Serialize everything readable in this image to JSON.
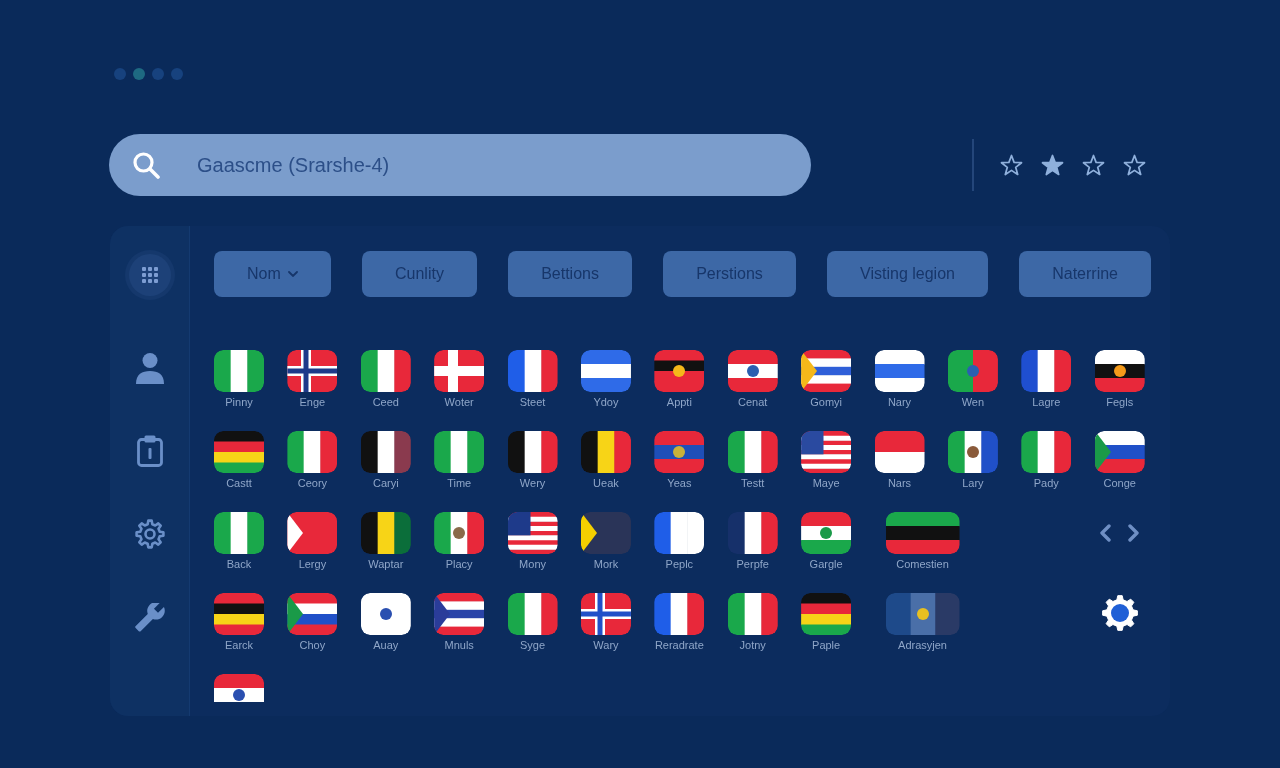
{
  "page_dots": [
    {
      "selected": false
    },
    {
      "selected": true
    },
    {
      "selected": false
    },
    {
      "selected": false
    }
  ],
  "search": {
    "value": "Gaascme (Srarshe-4)"
  },
  "star_buttons": [
    {
      "filled": false
    },
    {
      "filled": true
    },
    {
      "filled": false
    },
    {
      "filled": false
    }
  ],
  "sidebar": {
    "items": [
      {
        "kind": "grid",
        "selected": true
      },
      {
        "kind": "person",
        "selected": false
      },
      {
        "kind": "clipboard",
        "selected": false
      },
      {
        "kind": "gear",
        "selected": false
      },
      {
        "kind": "wrench",
        "selected": false
      }
    ]
  },
  "filters": [
    {
      "label": "Nom",
      "dropdown": true
    },
    {
      "label": "Cunlity"
    },
    {
      "label": "Bettions"
    },
    {
      "label": "Perstions"
    },
    {
      "label": "Visting legion"
    },
    {
      "label": "Naterrine"
    }
  ],
  "flag_grid": {
    "rows": [
      {
        "tiles": [
          {
            "label": "Pinny"
          },
          {
            "label": "Enge"
          },
          {
            "label": "Ceed"
          },
          {
            "label": "Woter"
          },
          {
            "label": "Steet"
          },
          {
            "label": "Ydoy"
          },
          {
            "label": "Appti"
          },
          {
            "label": "Cenat"
          },
          {
            "label": "Gomyi"
          },
          {
            "label": "Nary"
          },
          {
            "label": "Wen"
          },
          {
            "label": "Lagre"
          },
          {
            "label": "Fegls"
          }
        ]
      },
      {
        "tiles": [
          {
            "label": "Castt"
          },
          {
            "label": "Ceory"
          },
          {
            "label": "Caryi"
          },
          {
            "label": "Time"
          },
          {
            "label": "Wery"
          },
          {
            "label": "Ueak"
          },
          {
            "label": "Yeas"
          },
          {
            "label": "Testt"
          },
          {
            "label": "Maye"
          },
          {
            "label": "Nars"
          },
          {
            "label": "Lary"
          },
          {
            "label": "Pady"
          },
          {
            "label": "Conge"
          }
        ]
      },
      {
        "tiles": [
          {
            "label": "Back"
          },
          {
            "label": "Lergy"
          },
          {
            "label": "Waptar"
          },
          {
            "label": "Placy"
          },
          {
            "label": "Mony"
          },
          {
            "label": "Mork"
          },
          {
            "label": "Peplc"
          },
          {
            "label": "Perpfe"
          },
          {
            "label": "Gargle"
          },
          {
            "label": "Comestien"
          }
        ]
      },
      {
        "tiles": [
          {
            "label": "Earck"
          },
          {
            "label": "Choy"
          },
          {
            "label": "Auay"
          },
          {
            "label": "Mnuls"
          },
          {
            "label": "Syge"
          },
          {
            "label": "Wary"
          },
          {
            "label": "Reradrate"
          },
          {
            "label": "Jotny"
          },
          {
            "label": "Paple"
          },
          {
            "label": "Adrasyjen"
          }
        ]
      },
      {
        "tiles": [
          {
            "cut_off": true
          }
        ]
      }
    ]
  }
}
